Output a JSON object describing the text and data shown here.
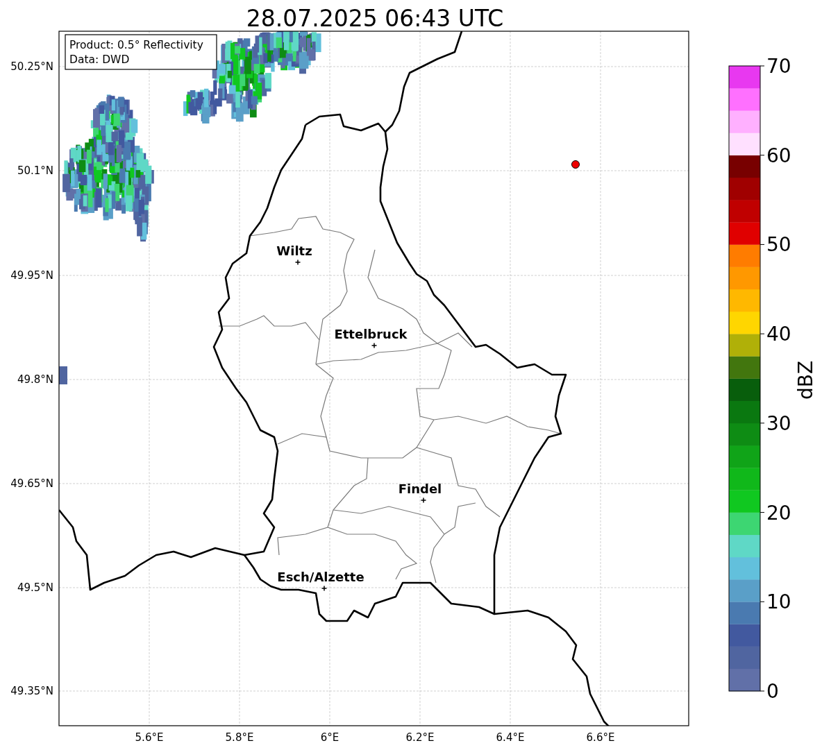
{
  "title": "28.07.2025 06:43 UTC",
  "info_box": [
    "Product: 0.5° Reflectivity",
    "Data: DWD"
  ],
  "map": {
    "cities": [
      "Wiltz",
      "Ettelbruck",
      "Findel",
      "Esch/Alzette"
    ],
    "x_tick_labels": [
      "5.6°E",
      "5.8°E",
      "6°E",
      "6.2°E",
      "6.4°E",
      "6.6°E"
    ],
    "y_tick_labels": [
      "50.25°N",
      "50.1°N",
      "49.95°N",
      "49.8°N",
      "49.65°N",
      "49.5°N",
      "49.35°N"
    ]
  },
  "colorbar": {
    "label": "dBZ",
    "ticks": [
      "70",
      "60",
      "50",
      "40",
      "30",
      "20",
      "10",
      "0"
    ],
    "bands": [
      {
        "color": "#6170a8"
      },
      {
        "color": "#5065a0"
      },
      {
        "color": "#42599f"
      },
      {
        "color": "#4a7ab0"
      },
      {
        "color": "#5a9fc8"
      },
      {
        "color": "#62c0dc"
      },
      {
        "color": "#5fd8c6"
      },
      {
        "color": "#3dd672"
      },
      {
        "color": "#10c820"
      },
      {
        "color": "#10b81a"
      },
      {
        "color": "#10a418"
      },
      {
        "color": "#0e8c14"
      },
      {
        "color": "#0a7810"
      },
      {
        "color": "#085e0c"
      },
      {
        "color": "#42760e"
      },
      {
        "color": "#b0b008"
      },
      {
        "color": "#ffd600"
      },
      {
        "color": "#ffb800"
      },
      {
        "color": "#ff9800"
      },
      {
        "color": "#ff7c00"
      },
      {
        "color": "#e00000"
      },
      {
        "color": "#c00000"
      },
      {
        "color": "#a00000"
      },
      {
        "color": "#780000"
      },
      {
        "color": "#ffe0ff"
      },
      {
        "color": "#ffb0ff"
      },
      {
        "color": "#ff70ff"
      },
      {
        "color": "#e838f0"
      }
    ]
  }
}
